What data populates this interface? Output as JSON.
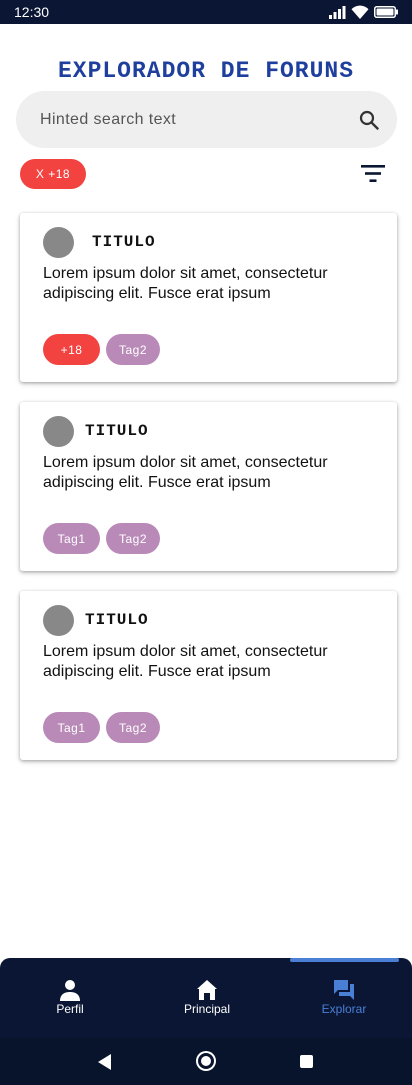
{
  "status_bar": {
    "time": "12:30",
    "icons": [
      "signal-icon",
      "wifi-icon",
      "battery-icon"
    ]
  },
  "header": {
    "title": "EXPLORADOR DE FORUNS"
  },
  "search": {
    "placeholder": "Hinted search text",
    "icon": "search-icon"
  },
  "filters": {
    "active_chip": "X +18",
    "filter_icon": "filter-list-icon"
  },
  "cards": [
    {
      "title": "TITULO",
      "body": "Lorem ipsum dolor sit amet, consectetur adipiscing elit. Fusce erat ipsum",
      "tags": [
        {
          "label": "+18",
          "color": "#f24341"
        },
        {
          "label": "Tag2",
          "color": "#b98ab8"
        }
      ]
    },
    {
      "title": "TITULO",
      "body": "Lorem ipsum dolor sit amet, consectetur adipiscing elit. Fusce erat ipsum",
      "tags": [
        {
          "label": "Tag1",
          "color": "#b98ab8"
        },
        {
          "label": "Tag2",
          "color": "#b98ab8"
        }
      ]
    },
    {
      "title": "TITULO",
      "body": "Lorem ipsum dolor sit amet, consectetur adipiscing elit. Fusce erat ipsum",
      "tags": [
        {
          "label": "Tag1",
          "color": "#b98ab8"
        },
        {
          "label": "Tag2",
          "color": "#b98ab8"
        }
      ]
    }
  ],
  "bottom_nav": {
    "items": [
      {
        "label": "Perfil",
        "icon": "person-icon",
        "active": false
      },
      {
        "label": "Principal",
        "icon": "home-icon",
        "active": false
      },
      {
        "label": "Explorar",
        "icon": "forum-icon",
        "active": true
      }
    ]
  },
  "colors": {
    "accent": "#1f3f9e",
    "nav_background": "#0a1633",
    "active_nav": "#4a7fd6",
    "nsfw_chip": "#f24341",
    "tag_chip": "#b98ab8"
  }
}
